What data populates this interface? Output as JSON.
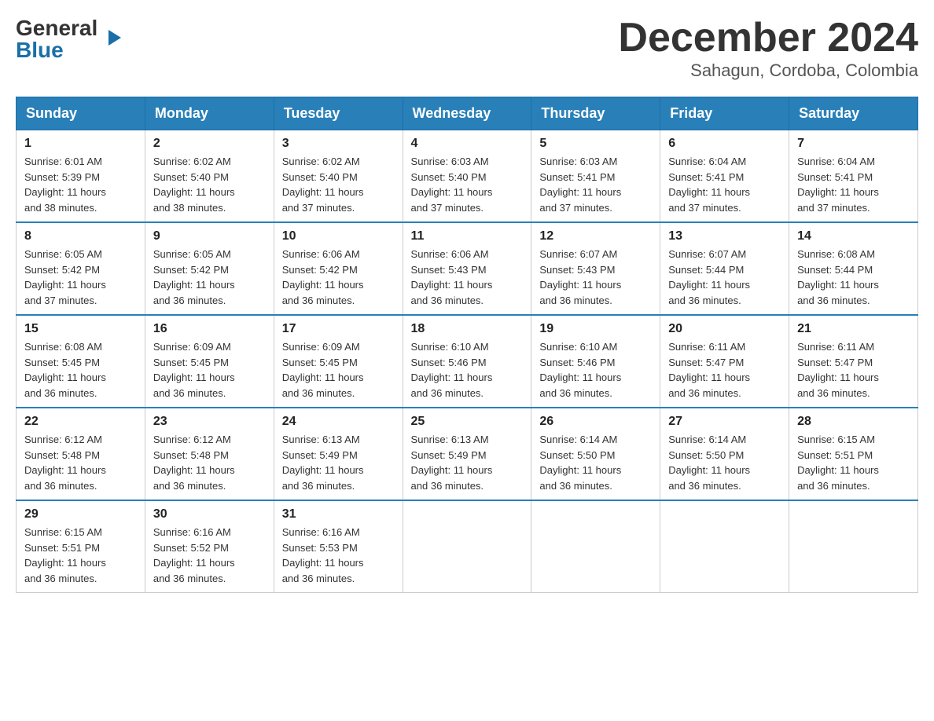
{
  "logo": {
    "general": "General",
    "blue": "Blue",
    "triangle_char": "▶"
  },
  "title": "December 2024",
  "location": "Sahagun, Cordoba, Colombia",
  "days_of_week": [
    "Sunday",
    "Monday",
    "Tuesday",
    "Wednesday",
    "Thursday",
    "Friday",
    "Saturday"
  ],
  "weeks": [
    [
      {
        "day": "1",
        "sunrise": "6:01 AM",
        "sunset": "5:39 PM",
        "daylight": "11 hours and 38 minutes."
      },
      {
        "day": "2",
        "sunrise": "6:02 AM",
        "sunset": "5:40 PM",
        "daylight": "11 hours and 38 minutes."
      },
      {
        "day": "3",
        "sunrise": "6:02 AM",
        "sunset": "5:40 PM",
        "daylight": "11 hours and 37 minutes."
      },
      {
        "day": "4",
        "sunrise": "6:03 AM",
        "sunset": "5:40 PM",
        "daylight": "11 hours and 37 minutes."
      },
      {
        "day": "5",
        "sunrise": "6:03 AM",
        "sunset": "5:41 PM",
        "daylight": "11 hours and 37 minutes."
      },
      {
        "day": "6",
        "sunrise": "6:04 AM",
        "sunset": "5:41 PM",
        "daylight": "11 hours and 37 minutes."
      },
      {
        "day": "7",
        "sunrise": "6:04 AM",
        "sunset": "5:41 PM",
        "daylight": "11 hours and 37 minutes."
      }
    ],
    [
      {
        "day": "8",
        "sunrise": "6:05 AM",
        "sunset": "5:42 PM",
        "daylight": "11 hours and 37 minutes."
      },
      {
        "day": "9",
        "sunrise": "6:05 AM",
        "sunset": "5:42 PM",
        "daylight": "11 hours and 36 minutes."
      },
      {
        "day": "10",
        "sunrise": "6:06 AM",
        "sunset": "5:42 PM",
        "daylight": "11 hours and 36 minutes."
      },
      {
        "day": "11",
        "sunrise": "6:06 AM",
        "sunset": "5:43 PM",
        "daylight": "11 hours and 36 minutes."
      },
      {
        "day": "12",
        "sunrise": "6:07 AM",
        "sunset": "5:43 PM",
        "daylight": "11 hours and 36 minutes."
      },
      {
        "day": "13",
        "sunrise": "6:07 AM",
        "sunset": "5:44 PM",
        "daylight": "11 hours and 36 minutes."
      },
      {
        "day": "14",
        "sunrise": "6:08 AM",
        "sunset": "5:44 PM",
        "daylight": "11 hours and 36 minutes."
      }
    ],
    [
      {
        "day": "15",
        "sunrise": "6:08 AM",
        "sunset": "5:45 PM",
        "daylight": "11 hours and 36 minutes."
      },
      {
        "day": "16",
        "sunrise": "6:09 AM",
        "sunset": "5:45 PM",
        "daylight": "11 hours and 36 minutes."
      },
      {
        "day": "17",
        "sunrise": "6:09 AM",
        "sunset": "5:45 PM",
        "daylight": "11 hours and 36 minutes."
      },
      {
        "day": "18",
        "sunrise": "6:10 AM",
        "sunset": "5:46 PM",
        "daylight": "11 hours and 36 minutes."
      },
      {
        "day": "19",
        "sunrise": "6:10 AM",
        "sunset": "5:46 PM",
        "daylight": "11 hours and 36 minutes."
      },
      {
        "day": "20",
        "sunrise": "6:11 AM",
        "sunset": "5:47 PM",
        "daylight": "11 hours and 36 minutes."
      },
      {
        "day": "21",
        "sunrise": "6:11 AM",
        "sunset": "5:47 PM",
        "daylight": "11 hours and 36 minutes."
      }
    ],
    [
      {
        "day": "22",
        "sunrise": "6:12 AM",
        "sunset": "5:48 PM",
        "daylight": "11 hours and 36 minutes."
      },
      {
        "day": "23",
        "sunrise": "6:12 AM",
        "sunset": "5:48 PM",
        "daylight": "11 hours and 36 minutes."
      },
      {
        "day": "24",
        "sunrise": "6:13 AM",
        "sunset": "5:49 PM",
        "daylight": "11 hours and 36 minutes."
      },
      {
        "day": "25",
        "sunrise": "6:13 AM",
        "sunset": "5:49 PM",
        "daylight": "11 hours and 36 minutes."
      },
      {
        "day": "26",
        "sunrise": "6:14 AM",
        "sunset": "5:50 PM",
        "daylight": "11 hours and 36 minutes."
      },
      {
        "day": "27",
        "sunrise": "6:14 AM",
        "sunset": "5:50 PM",
        "daylight": "11 hours and 36 minutes."
      },
      {
        "day": "28",
        "sunrise": "6:15 AM",
        "sunset": "5:51 PM",
        "daylight": "11 hours and 36 minutes."
      }
    ],
    [
      {
        "day": "29",
        "sunrise": "6:15 AM",
        "sunset": "5:51 PM",
        "daylight": "11 hours and 36 minutes."
      },
      {
        "day": "30",
        "sunrise": "6:16 AM",
        "sunset": "5:52 PM",
        "daylight": "11 hours and 36 minutes."
      },
      {
        "day": "31",
        "sunrise": "6:16 AM",
        "sunset": "5:53 PM",
        "daylight": "11 hours and 36 minutes."
      },
      null,
      null,
      null,
      null
    ]
  ],
  "labels": {
    "sunrise": "Sunrise:",
    "sunset": "Sunset:",
    "daylight": "Daylight:"
  }
}
